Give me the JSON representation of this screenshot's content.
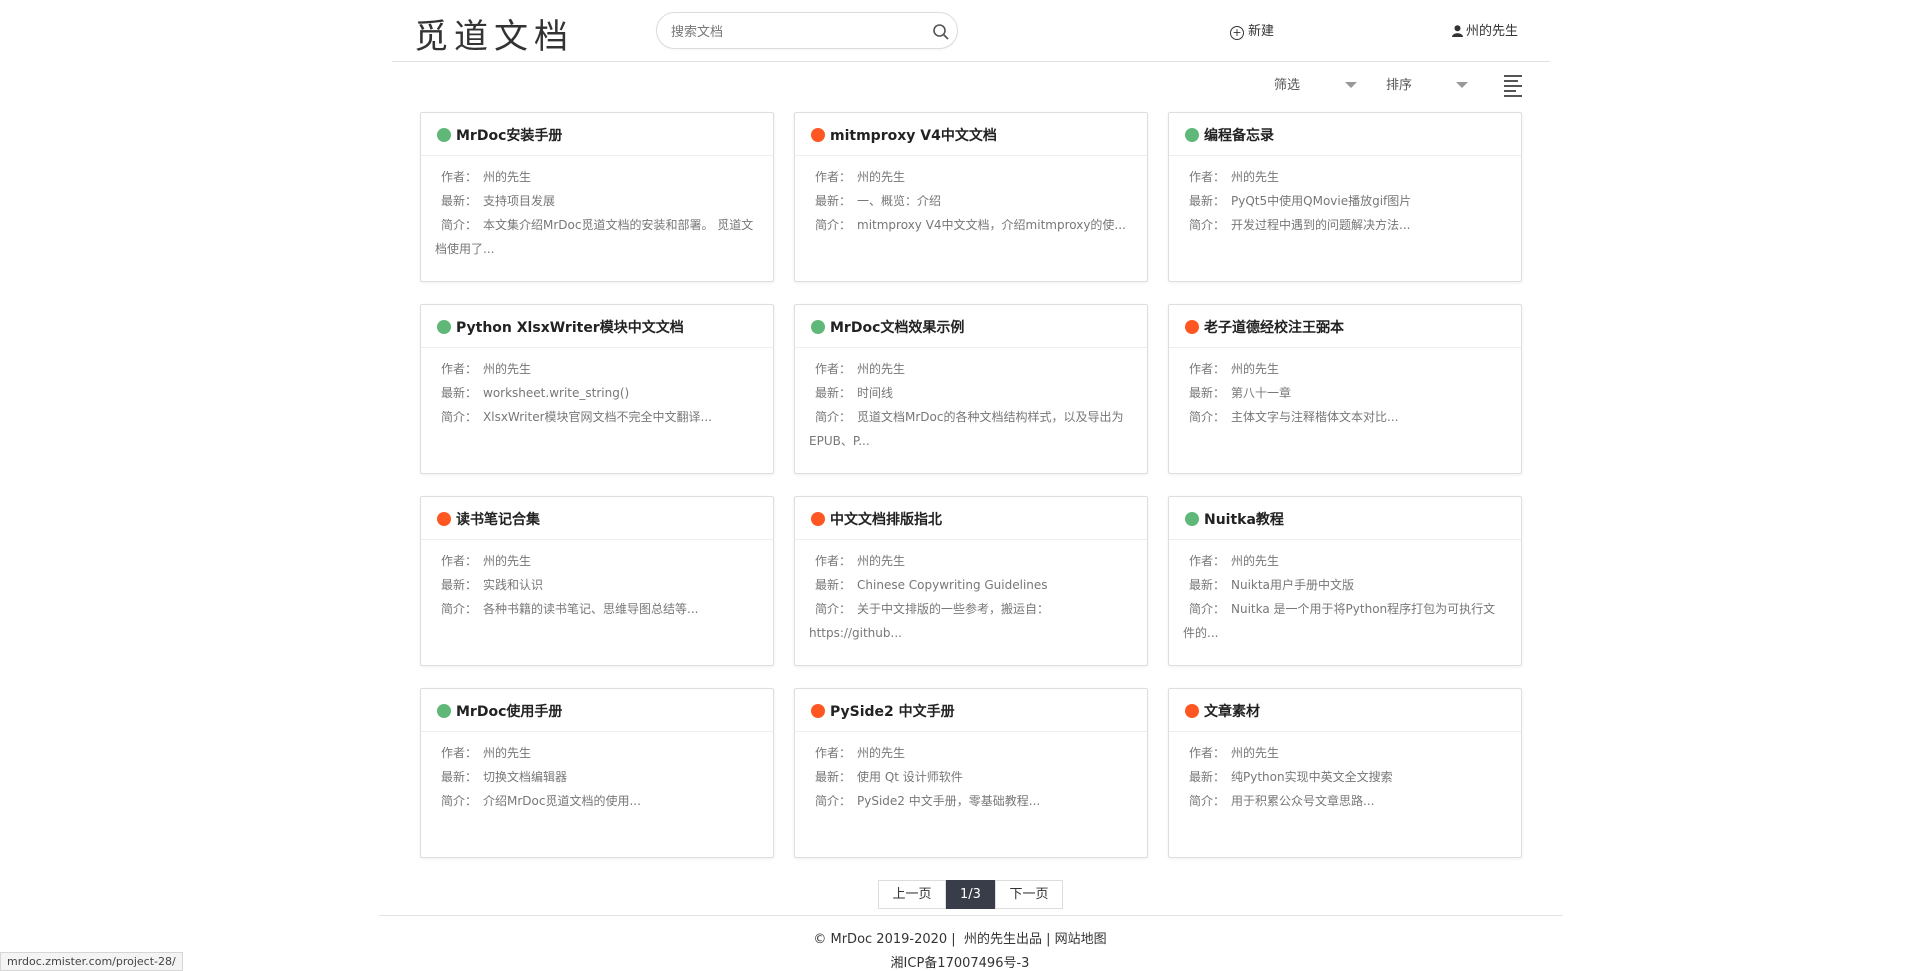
{
  "header": {
    "logo": "觅道文档",
    "search_placeholder": "搜索文档",
    "new_label": "新建",
    "user_label": "州的先生"
  },
  "toolbar": {
    "filter_label": "筛选",
    "sort_label": "排序"
  },
  "colors": {
    "green": "#5FB878",
    "orange": "#FF5722"
  },
  "labels": {
    "author": "作者：",
    "latest": "最新：",
    "intro": "简介："
  },
  "projects": [
    {
      "title": "MrDoc安装手册",
      "status": "green",
      "author": "州的先生",
      "latest": "支持项目发展",
      "intro": "本文集介绍MrDoc觅道文档的安装和部署。 觅道文档使用了..."
    },
    {
      "title": "mitmproxy V4中文文档",
      "status": "orange",
      "author": "州的先生",
      "latest": "一、概览：介绍",
      "intro": "mitmproxy V4中文文档，介绍mitmproxy的使..."
    },
    {
      "title": "编程备忘录",
      "status": "green",
      "author": "州的先生",
      "latest": "PyQt5中使用QMovie播放gif图片",
      "intro": "开发过程中遇到的问题解决方法..."
    },
    {
      "title": "Python XlsxWriter模块中文文档",
      "status": "green",
      "author": "州的先生",
      "latest": "worksheet.write_string()",
      "intro": "XlsxWriter模块官网文档不完全中文翻译..."
    },
    {
      "title": "MrDoc文档效果示例",
      "status": "green",
      "author": "州的先生",
      "latest": "时间线",
      "intro": "觅道文档MrDoc的各种文档结构样式，以及导出为EPUB、P..."
    },
    {
      "title": "老子道德经校注王弼本",
      "status": "orange",
      "author": "州的先生",
      "latest": "第八十一章",
      "intro": "主体文字与注释楷体文本对比..."
    },
    {
      "title": "读书笔记合集",
      "status": "orange",
      "author": "州的先生",
      "latest": "实践和认识",
      "intro": "各种书籍的读书笔记、思维导图总结等..."
    },
    {
      "title": "中文文档排版指北",
      "status": "orange",
      "author": "州的先生",
      "latest": "Chinese Copywriting Guidelines",
      "intro": "关于中文排版的一些参考，搬运自：https://github..."
    },
    {
      "title": "Nuitka教程",
      "status": "green",
      "author": "州的先生",
      "latest": "Nuikta用户手册中文版",
      "intro": "Nuitka 是一个用于将Python程序打包为可执行文件的..."
    },
    {
      "title": "MrDoc使用手册",
      "status": "green",
      "author": "州的先生",
      "latest": "切换文档编辑器",
      "intro": "介绍MrDoc觅道文档的使用..."
    },
    {
      "title": "PySide2 中文手册",
      "status": "orange",
      "author": "州的先生",
      "latest": "使用 Qt 设计师软件",
      "intro": "PySide2 中文手册，零基础教程..."
    },
    {
      "title": "文章素材",
      "status": "orange",
      "author": "州的先生",
      "latest": "纯Python实现中英文全文搜索",
      "intro": "用于积累公众号文章思路..."
    }
  ],
  "pagination": {
    "prev": "上一页",
    "current": "1/3",
    "next": "下一页"
  },
  "footer": {
    "copyright": "© MrDoc 2019-2020",
    "producer": "州的先生出品",
    "sitemap": "网站地图",
    "icp": "湘ICP备17007496号-3"
  },
  "status_url": "mrdoc.zmister.com/project-28/"
}
